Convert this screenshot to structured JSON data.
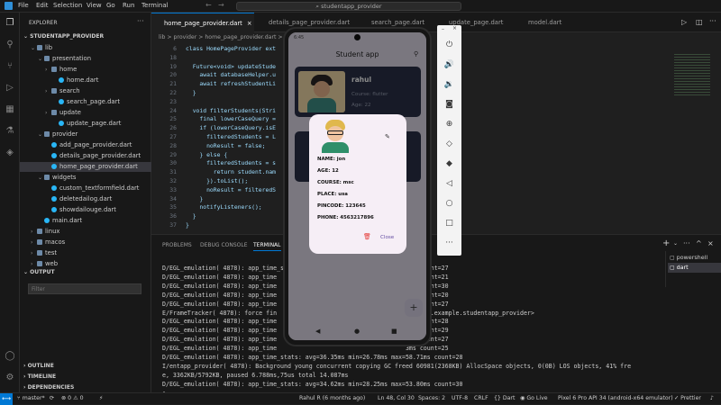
{
  "menu": [
    "File",
    "Edit",
    "Selection",
    "View",
    "Go",
    "Run",
    "Terminal"
  ],
  "search_text": "studentapp_provider",
  "explorer": {
    "title": "EXPLORER",
    "root": "STUDENTAPP_PROVIDER",
    "items": [
      {
        "label": "lib",
        "depth": 1,
        "kind": "folder"
      },
      {
        "label": "presentation",
        "depth": 2,
        "kind": "folder"
      },
      {
        "label": "home",
        "depth": 3,
        "kind": "folder"
      },
      {
        "label": "home.dart",
        "depth": 4,
        "kind": "dart"
      },
      {
        "label": "search",
        "depth": 3,
        "kind": "folder"
      },
      {
        "label": "search_page.dart",
        "depth": 4,
        "kind": "dart"
      },
      {
        "label": "update",
        "depth": 3,
        "kind": "folder"
      },
      {
        "label": "update_page.dart",
        "depth": 4,
        "kind": "dart"
      },
      {
        "label": "provider",
        "depth": 2,
        "kind": "folder"
      },
      {
        "label": "add_page_provider.dart",
        "depth": 3,
        "kind": "dart"
      },
      {
        "label": "details_page_provider.dart",
        "depth": 3,
        "kind": "dart"
      },
      {
        "label": "home_page_provider.dart",
        "depth": 3,
        "kind": "dart",
        "selected": true
      },
      {
        "label": "widgets",
        "depth": 2,
        "kind": "folder"
      },
      {
        "label": "custom_textformfield.dart",
        "depth": 3,
        "kind": "dart"
      },
      {
        "label": "deletedailog.dart",
        "depth": 3,
        "kind": "dart"
      },
      {
        "label": "showdailouge.dart",
        "depth": 3,
        "kind": "dart"
      },
      {
        "label": "main.dart",
        "depth": 2,
        "kind": "dart"
      },
      {
        "label": "linux",
        "depth": 1,
        "kind": "folder"
      },
      {
        "label": "macos",
        "depth": 1,
        "kind": "folder"
      },
      {
        "label": "test",
        "depth": 1,
        "kind": "folder"
      },
      {
        "label": "web",
        "depth": 1,
        "kind": "folder"
      }
    ],
    "output_label": "OUTPUT",
    "filter_placeholder": "Filter",
    "sections": [
      "OUTLINE",
      "TIMELINE",
      "DEPENDENCIES"
    ]
  },
  "tabs": [
    "home_page_provider.dart",
    "details_page_provider.dart",
    "search_page.dart",
    "update_page.dart",
    "model.dart"
  ],
  "breadcrumb": "lib > provider > home_page_provider.dart > ...",
  "code": [
    {
      "n": "6",
      "t": "class HomePageProvider ext"
    },
    {
      "n": "18",
      "t": ""
    },
    {
      "n": "19",
      "t": "  Future<void> updateStude"
    },
    {
      "n": "20",
      "t": "    await databaseHelper.u"
    },
    {
      "n": "21",
      "t": "    await refreshStudentLi"
    },
    {
      "n": "22",
      "t": "  }"
    },
    {
      "n": "23",
      "t": ""
    },
    {
      "n": "24",
      "t": "  void filterStudents(Stri"
    },
    {
      "n": "25",
      "t": "    final lowerCaseQuery ="
    },
    {
      "n": "26",
      "t": "    if (lowerCaseQuery.isE"
    },
    {
      "n": "27",
      "t": "      filteredStudents = L"
    },
    {
      "n": "28",
      "t": "      noResult = false;"
    },
    {
      "n": "29",
      "t": "    } else {"
    },
    {
      "n": "30",
      "t": "      filteredStudents = s"
    },
    {
      "n": "31",
      "t": "        return student.nam"
    },
    {
      "n": "32",
      "t": "      }).toList();"
    },
    {
      "n": "33",
      "t": "      noResult = filteredS"
    },
    {
      "n": "34",
      "t": "    }"
    },
    {
      "n": "35",
      "t": "    notifyListeners();"
    },
    {
      "n": "36",
      "t": "  }"
    },
    {
      "n": "37",
      "t": "}"
    }
  ],
  "panel_tabs": [
    "PROBLEMS",
    "DEBUG CONSOLE",
    "TERMINAL"
  ],
  "terminal_lines": [
    "D/EGL_emulation( 4878): app_time_stats: avg=...                     2ms count=27",
    "D/EGL_emulation( 4878): app_time                                    1ms count=21",
    "D/EGL_emulation( 4878): app_time                                   33ms count=30",
    "D/EGL_emulation( 4878): app_time                                    3ms count=20",
    "D/EGL_emulation( 4878): app_time                                    6ms count=27",
    "E/FrameTracker( 4878): force fin                                 N::1@1@com.example.studentapp_provider>",
    "D/EGL_emulation( 4878): app_time                                    6ms count=28",
    "D/EGL_emulation( 4878): app_time                                    5ms count=29",
    "D/EGL_emulation( 4878): app_time                                    9ms count=27",
    "D/EGL_emulation( 4878): app_time                                    3ms count=25",
    "D/EGL_emulation( 4878): app_time_stats: avg=36.35ms min=26.78ms max=58.71ms count=28",
    "I/entapp_provider( 4878): Background young concurrent copying GC freed 60981(2368KB) AllocSpace objects, 0(0B) LOS objects, 41% fre",
    "e, 3362KB/5792KB, paused 6.788ms,75us total 14.087ms",
    "D/EGL_emulation( 4878): app_time_stats: avg=34.62ms min=28.25ms max=53.80ms count=30"
  ],
  "terminal_list": [
    "powershell",
    "dart"
  ],
  "status": {
    "branch": "master*",
    "errors": "0",
    "warnings": "0",
    "author": "Rahul R (6 months ago)",
    "position": "Ln 48, Col 30",
    "spaces": "Spaces: 2",
    "encoding": "UTF-8",
    "eol": "CRLF",
    "language": "Dart",
    "golive": "Go Live",
    "device": "Pixel 6 Pro API 34 (android-x64 emulator)",
    "prettier": "Prettier"
  },
  "phone": {
    "time": "6:45",
    "app_title": "Student app",
    "card": {
      "name": "rahul",
      "course": "Course: flutter",
      "age": "Age: 22"
    },
    "dialog": {
      "name": "NAME: jon",
      "age": "AGE: 12",
      "course": "COURSE: msc",
      "place": "PLACE: usa",
      "pincode": "PINCODE: 123645",
      "phone": "PHONE: 4563217896",
      "close": "Close"
    }
  }
}
